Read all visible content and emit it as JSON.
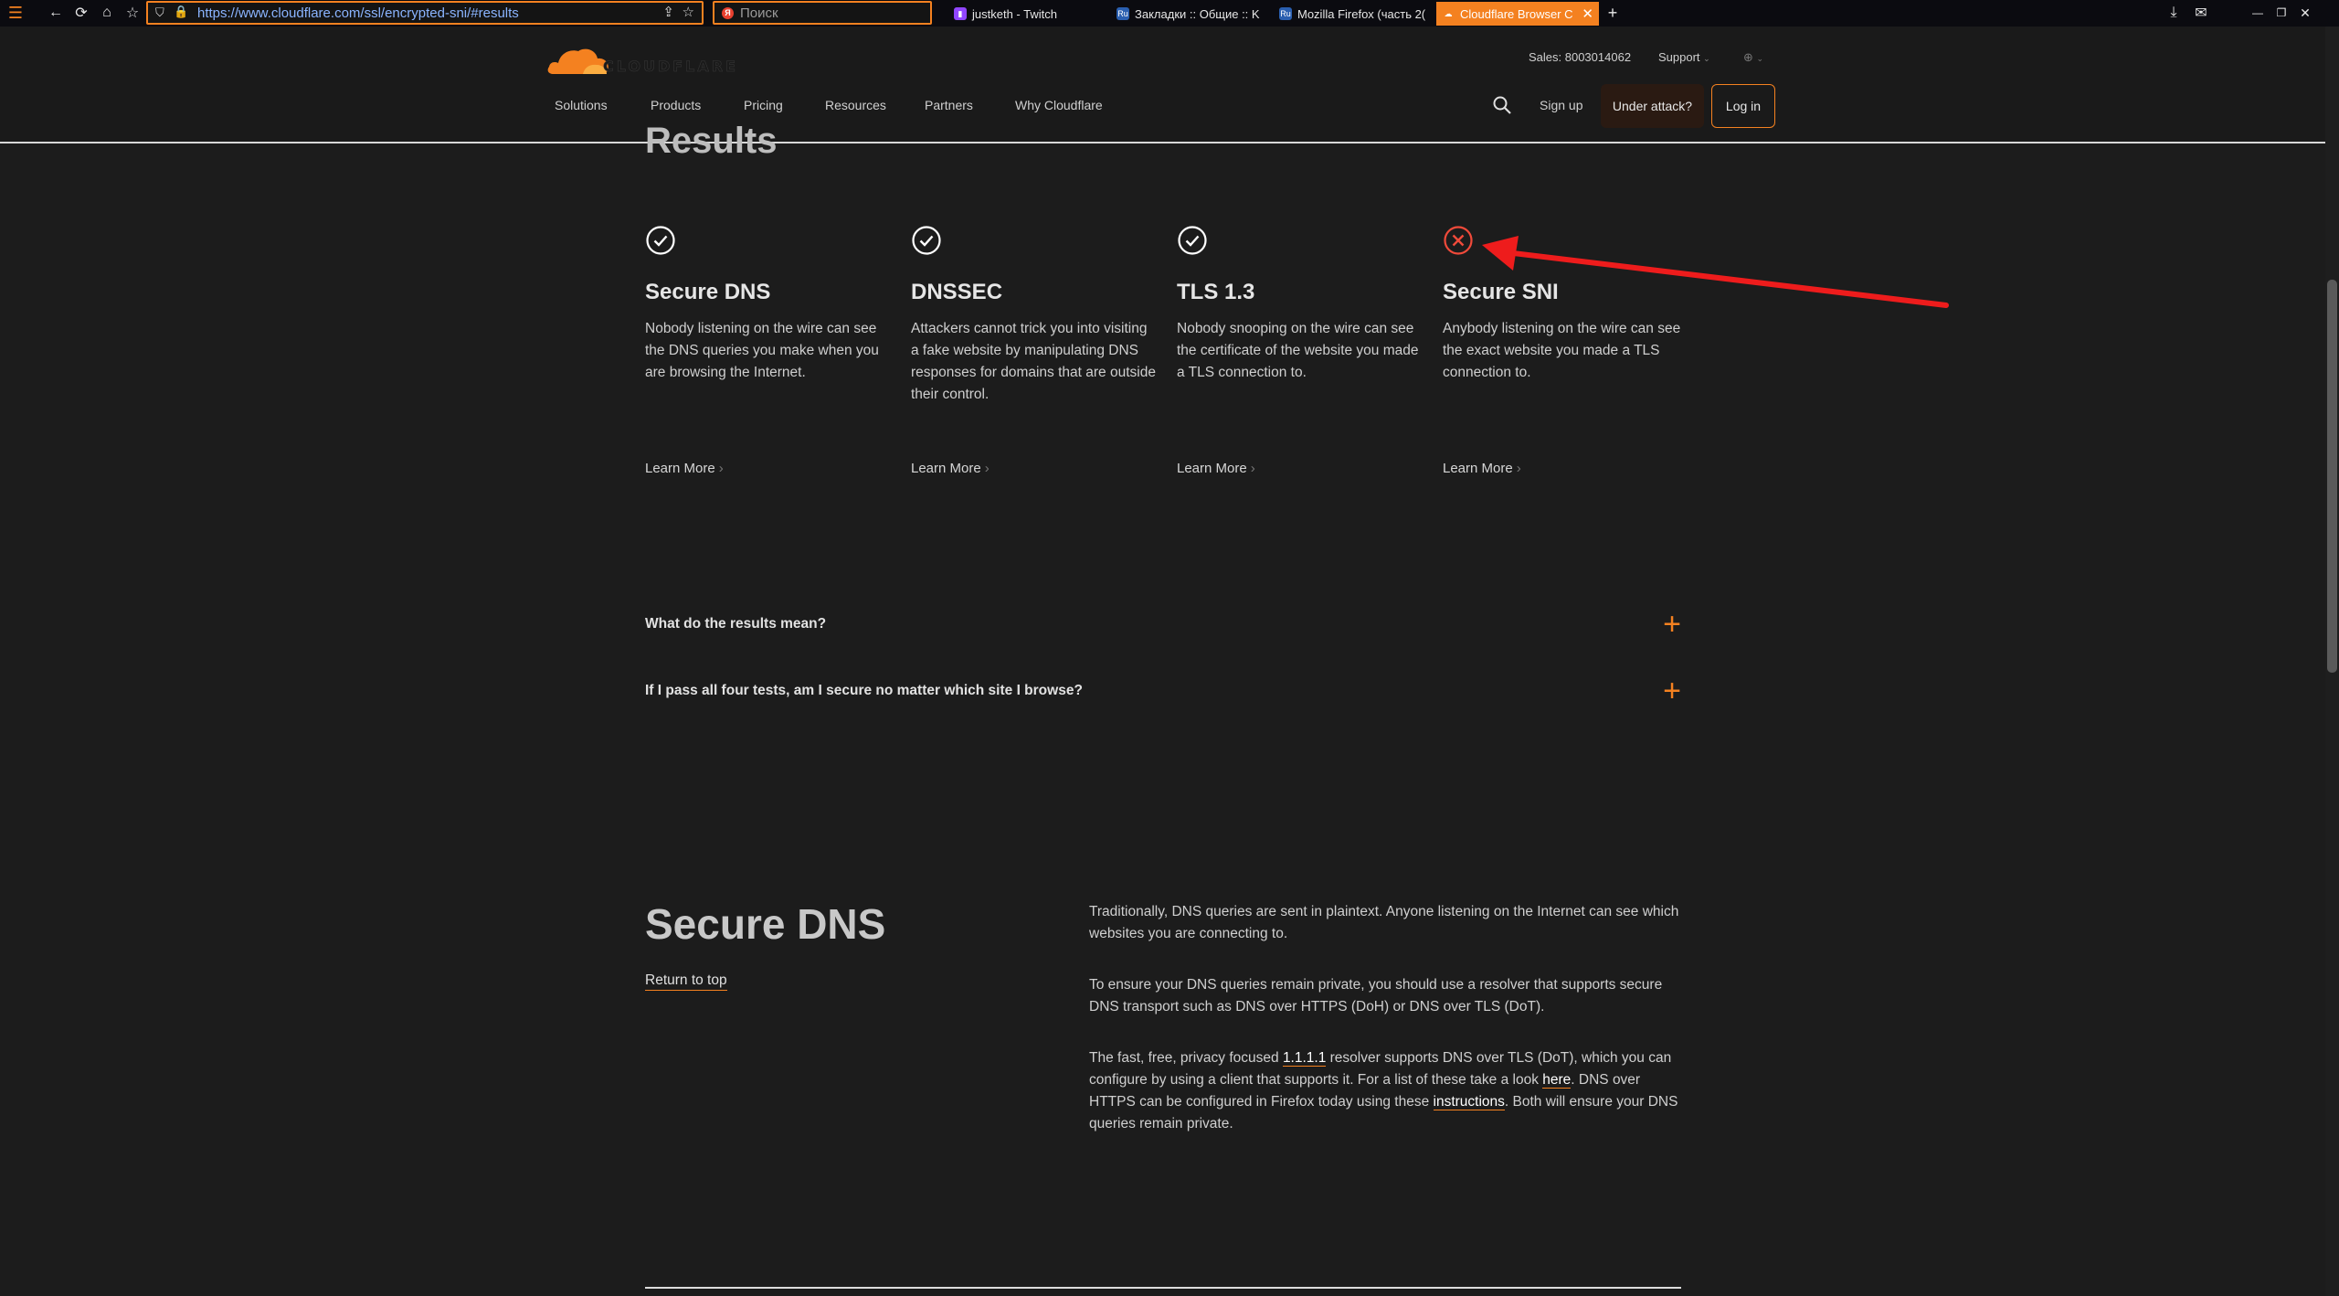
{
  "browser": {
    "url": "https://www.cloudflare.com/ssl/encrypted-sni/#results",
    "search_placeholder": "Поиск",
    "tabs": [
      {
        "label": "justketh - Twitch",
        "icon": "twitch-icon"
      },
      {
        "label": "Закладки :: Общие :: K",
        "icon": "ru-board-icon"
      },
      {
        "label": "Mozilla Firefox (часть 2(",
        "icon": "ru-board-icon"
      },
      {
        "label": "Cloudflare Browser C",
        "icon": "cloudflare-icon",
        "active": true
      }
    ]
  },
  "header": {
    "logo_text": "CLOUDFLARE",
    "sales": "Sales: 8003014062",
    "support": "Support",
    "nav": [
      "Solutions",
      "Products",
      "Pricing",
      "Resources",
      "Partners",
      "Why Cloudflare"
    ],
    "sign_up": "Sign up",
    "under_attack": "Under attack?",
    "log_in": "Log in"
  },
  "results": {
    "heading": "Results",
    "cards": [
      {
        "title": "Secure DNS",
        "status": "pass",
        "description": "Nobody listening on the wire can see the DNS queries you make when you are browsing the Internet.",
        "link": "Learn More"
      },
      {
        "title": "DNSSEC",
        "status": "pass",
        "description": "Attackers cannot trick you into visiting a fake website by manipulating DNS responses for domains that are outside their control.",
        "link": "Learn More"
      },
      {
        "title": "TLS 1.3",
        "status": "pass",
        "description": "Nobody snooping on the wire can see the certificate of the website you made a TLS connection to.",
        "link": "Learn More"
      },
      {
        "title": "Secure SNI",
        "status": "fail",
        "description": "Anybody listening on the wire can see the exact website you made a TLS connection to.",
        "link": "Learn More"
      }
    ]
  },
  "faq": [
    {
      "question": "What do the results mean?"
    },
    {
      "question": "If I pass all four tests, am I secure no matter which site I browse?"
    }
  ],
  "secure_dns": {
    "title": "Secure DNS",
    "return_to_top": "Return to top",
    "para1": "Traditionally, DNS queries are sent in plaintext. Anyone listening on the Internet can see which websites you are connecting to.",
    "para2": "To ensure your DNS queries remain private, you should use a resolver that supports secure DNS transport such as DNS over HTTPS (DoH) or DNS over TLS (DoT).",
    "para3_a": "The fast, free, privacy focused ",
    "para3_link1": "1.1.1.1",
    "para3_b": " resolver supports DNS over TLS (DoT), which you can configure by using a client that supports it. For a list of these take a look ",
    "para3_link2": "here",
    "para3_c": ". DNS over HTTPS can be configured in Firefox today using these ",
    "para3_link3": "instructions",
    "para3_d": ". Both will ensure your DNS queries remain private."
  },
  "colors": {
    "accent": "#f48120",
    "pass": "#ffffff",
    "fail": "#f04a3a",
    "annotation_arrow": "#ee1c1c",
    "background": "#1c1c1c"
  }
}
